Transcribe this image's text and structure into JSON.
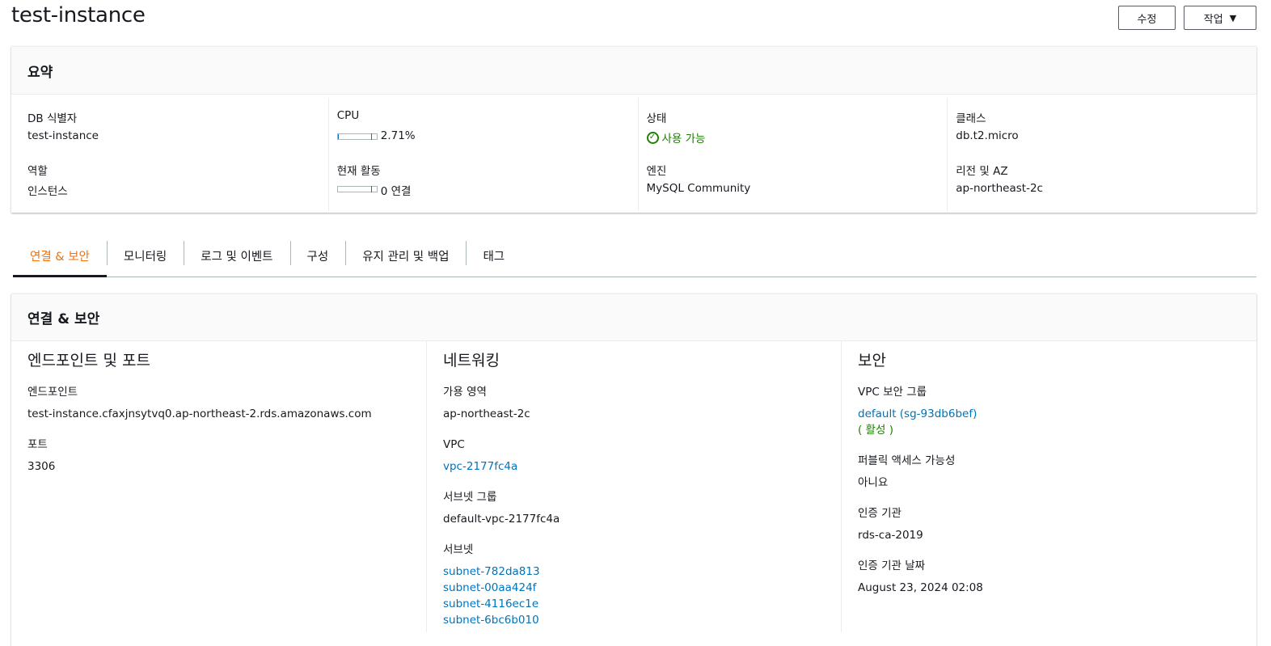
{
  "header": {
    "title": "test-instance",
    "edit_label": "수정",
    "actions_label": "작업"
  },
  "summary": {
    "title": "요약",
    "db_id_label": "DB 식별자",
    "db_id_value": "test-instance",
    "role_label": "역할",
    "role_value": "인스턴스",
    "cpu_label": "CPU",
    "cpu_value": "2.71%",
    "cpu_percent": 2.71,
    "activity_label": "현재 활동",
    "activity_value": "0 연결",
    "status_label": "상태",
    "status_value": "사용 가능",
    "engine_label": "엔진",
    "engine_value": "MySQL Community",
    "class_label": "클래스",
    "class_value": "db.t2.micro",
    "region_label": "리전 및 AZ",
    "region_value": "ap-northeast-2c"
  },
  "tabs": [
    {
      "label": "연결 & 보안"
    },
    {
      "label": "모니터링"
    },
    {
      "label": "로그 및 이벤트"
    },
    {
      "label": "구성"
    },
    {
      "label": "유지 관리 및 백업"
    },
    {
      "label": "태그"
    }
  ],
  "connectivity": {
    "title": "연결 & 보안",
    "endpoint": {
      "title": "엔드포인트 및 포트",
      "endpoint_label": "엔드포인트",
      "endpoint_value": "test-instance.cfaxjnsytvq0.ap-northeast-2.rds.amazonaws.com",
      "port_label": "포트",
      "port_value": "3306"
    },
    "networking": {
      "title": "네트워킹",
      "az_label": "가용 영역",
      "az_value": "ap-northeast-2c",
      "vpc_label": "VPC",
      "vpc_value": "vpc-2177fc4a",
      "subnet_group_label": "서브넷 그룹",
      "subnet_group_value": "default-vpc-2177fc4a",
      "subnets_label": "서브넷",
      "subnets": [
        "subnet-782da813",
        "subnet-00aa424f",
        "subnet-4116ec1e",
        "subnet-6bc6b010"
      ]
    },
    "security": {
      "title": "보안",
      "sg_label": "VPC 보안 그룹",
      "sg_value": "default (sg-93db6bef)",
      "sg_status": "( 활성 )",
      "public_label": "퍼블릭 액세스 가능성",
      "public_value": "아니요",
      "ca_label": "인증 기관",
      "ca_value": "rds-ca-2019",
      "ca_date_label": "인증 기관 날짜",
      "ca_date_value": "August 23, 2024 02:08"
    }
  },
  "colors": {
    "accent": "#ec7211",
    "link": "#0073bb",
    "success": "#1d8102"
  }
}
